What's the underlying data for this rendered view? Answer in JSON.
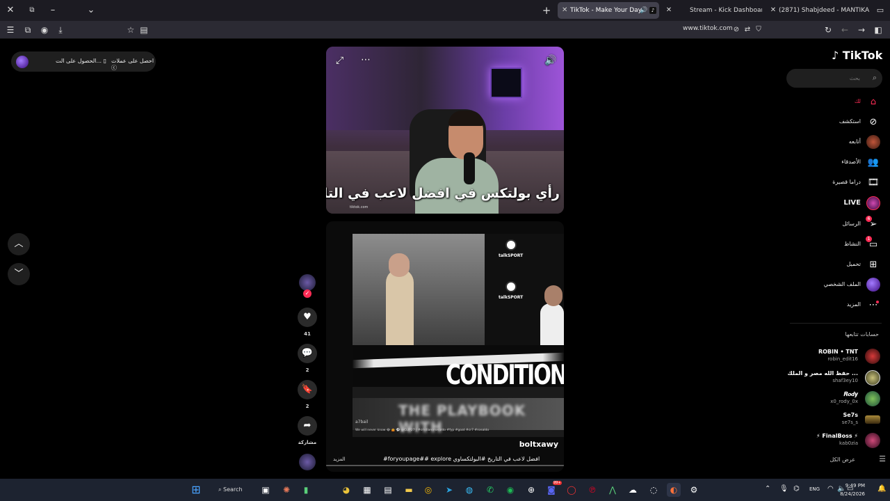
{
  "browser": {
    "tabs": [
      {
        "title": "TikTok - Make Your Day",
        "active": true
      },
      {
        "title": "Stream - Kick Dashboard",
        "active": false
      },
      {
        "title": "(2871) Shabjdeed - MANTIKA",
        "active": false
      }
    ],
    "url": "www.tiktok.com",
    "new_tab": "+",
    "colors": {
      "kick": "#53fc18",
      "youtube": "#ff0033",
      "tiktok": "#000000"
    }
  },
  "promo": {
    "get_coins": "احصل على عملات",
    "get_app": "الحصول على الت..."
  },
  "video1": {
    "caption": "رأي بولتكس في افضل لاعب في التاريخ:",
    "watermark": "tiktok.com"
  },
  "video2": {
    "author": "boltxawy",
    "description": "افضل لاعب في التاريخ #البولتكساوي foryoupage## explore#",
    "more": "المزيد",
    "headline": "CONDITIONS",
    "banner": "THE PLAYBOOK WITH",
    "small_id": "a7bail",
    "small_caption": "We will never know 😂 🤷 ⚽ @CLIP27 | #cristianoronaldo #fyp #goat #cr7 #ronaldo",
    "brand": "talkSPORT"
  },
  "actions": {
    "likes": "41",
    "comments": "2",
    "saves": "2",
    "share_label": "مشاركة"
  },
  "sidebar": {
    "logo": "TikTok",
    "search_placeholder": "بحث",
    "items": [
      {
        "label": "لك",
        "icon": "home-icon"
      },
      {
        "label": "استكشف",
        "icon": "compass-icon"
      },
      {
        "label": "أتابعه",
        "icon": "avatar"
      },
      {
        "label": "الأصدقاء",
        "icon": "friends-icon"
      },
      {
        "label": "دراما قصيرة",
        "icon": "film-icon"
      },
      {
        "label": "LIVE",
        "icon": "live-icon"
      },
      {
        "label": "الرسائل",
        "icon": "send-icon",
        "badge": "6"
      },
      {
        "label": "النشاط",
        "icon": "activity-icon",
        "badge": "1"
      },
      {
        "label": "تحميل",
        "icon": "upload-icon"
      },
      {
        "label": "الملف الشخصي",
        "icon": "profile-icon"
      },
      {
        "label": "المزيد",
        "icon": "more-icon"
      }
    ],
    "following_title": "حسابات تتابعها",
    "accounts": [
      {
        "name": "ROBIN • TNT",
        "handle": "robin_edit16"
      },
      {
        "name": "حفظ الله مصر و الملك ...",
        "handle": "shaf3ey10"
      },
      {
        "name": "𝑹𝒐𝒅𝒚",
        "handle": "x0_rody_0x"
      },
      {
        "name": "Se7s",
        "handle": "se7s_s"
      },
      {
        "name": "⚡ FinalBoss ⚡",
        "handle": "kab0zia"
      }
    ],
    "see_all": "عرض الكل"
  },
  "taskbar": {
    "search": "Search",
    "lang": "ENG",
    "time": "9:49 PM",
    "date": "8/24/2026",
    "badge": "99+"
  }
}
